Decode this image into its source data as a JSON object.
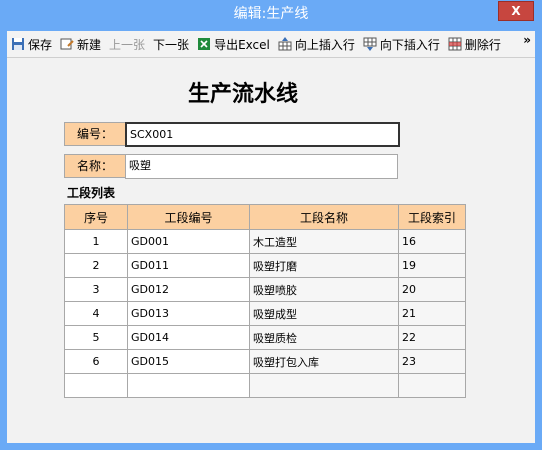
{
  "window": {
    "title": "编辑:生产线",
    "close_label": "X"
  },
  "toolbar": {
    "items": [
      {
        "label": "保存",
        "icon": "save-icon",
        "enabled": true
      },
      {
        "label": "新建",
        "icon": "new-icon",
        "enabled": true
      },
      {
        "label": "上一张",
        "icon": "",
        "enabled": false
      },
      {
        "label": "下一张",
        "icon": "",
        "enabled": true
      },
      {
        "label": "导出Excel",
        "icon": "excel-icon",
        "enabled": true
      },
      {
        "label": "向上插入行",
        "icon": "insert-row-up-icon",
        "enabled": true
      },
      {
        "label": "向下插入行",
        "icon": "insert-row-down-icon",
        "enabled": true
      },
      {
        "label": "删除行",
        "icon": "delete-row-icon",
        "enabled": true
      }
    ],
    "more_label": "»"
  },
  "form": {
    "title": "生产流水线",
    "code_label": "编号：",
    "code_value": "SCX001",
    "name_label": "名称：",
    "name_value": "吸塑"
  },
  "stages": {
    "title": "工段列表",
    "columns": [
      "序号",
      "工段编号",
      "工段名称",
      "工段索引"
    ],
    "rows": [
      [
        "1",
        "GD001",
        "木工造型",
        "16"
      ],
      [
        "2",
        "GD011",
        "吸塑打磨",
        "19"
      ],
      [
        "3",
        "GD012",
        "吸塑喷胶",
        "20"
      ],
      [
        "4",
        "GD013",
        "吸塑成型",
        "21"
      ],
      [
        "5",
        "GD014",
        "吸塑质检",
        "22"
      ],
      [
        "6",
        "GD015",
        "吸塑打包入库",
        "23"
      ]
    ]
  },
  "colors": {
    "titlebar": "#6aaaf6",
    "label_fill": "#fcd0a1",
    "close": "#c7463f"
  }
}
